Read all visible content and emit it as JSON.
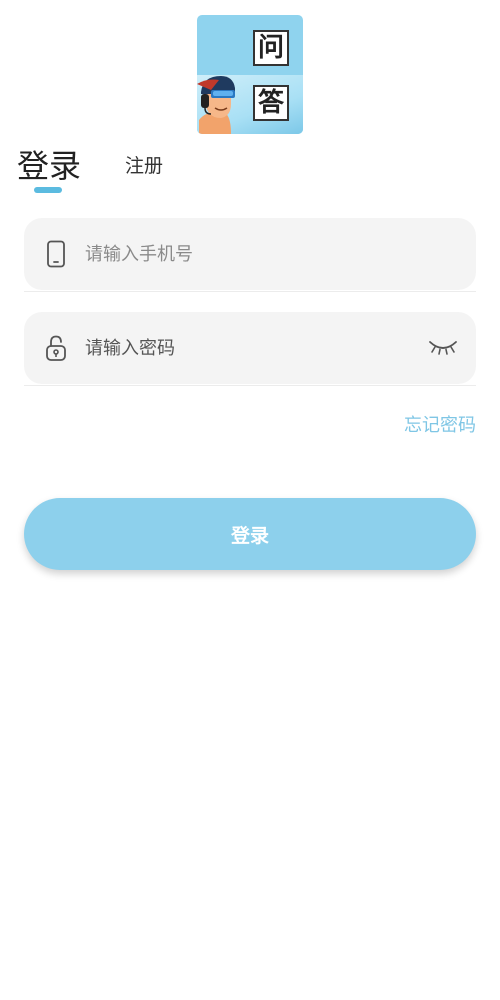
{
  "logo": {
    "char_top": "问",
    "char_bottom": "答",
    "icon": "qa-app-logo"
  },
  "tabs": {
    "login_label": "登录",
    "register_label": "注册",
    "active": "login"
  },
  "phone_field": {
    "placeholder": "请输入手机号",
    "value": "",
    "icon": "phone-icon"
  },
  "password_field": {
    "placeholder": "请输入密码",
    "value": "",
    "icon": "lock-icon",
    "toggle_icon": "eye-closed-icon"
  },
  "forgot_label": "忘记密码",
  "submit_label": "登录",
  "colors": {
    "accent": "#8dd0ec",
    "link": "#7fc6e5",
    "indicator": "#5bbbe0",
    "field_bg": "#f4f4f4"
  }
}
